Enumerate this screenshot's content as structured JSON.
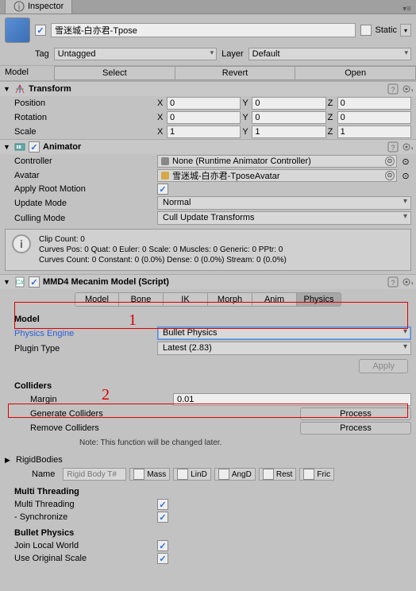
{
  "tab": {
    "title": "Inspector"
  },
  "object": {
    "enabled": true,
    "name": "雪迷城-白亦君-Tpose",
    "static_label": "Static",
    "tag_label": "Tag",
    "tag_value": "Untagged",
    "layer_label": "Layer",
    "layer_value": "Default",
    "model_label": "Model",
    "select_btn": "Select",
    "revert_btn": "Revert",
    "open_btn": "Open"
  },
  "transform": {
    "title": "Transform",
    "position_label": "Position",
    "rotation_label": "Rotation",
    "scale_label": "Scale",
    "X": "X",
    "Y": "Y",
    "Z": "Z",
    "px": "0",
    "py": "0",
    "pz": "0",
    "rx": "0",
    "ry": "0",
    "rz": "0",
    "sx": "1",
    "sy": "1",
    "sz": "1"
  },
  "animator": {
    "title": "Animator",
    "controller_label": "Controller",
    "controller_value": "None (Runtime Animator Controller)",
    "avatar_label": "Avatar",
    "avatar_value": "雪迷城-白亦君-TposeAvatar",
    "apply_root_label": "Apply Root Motion",
    "apply_root": true,
    "update_mode_label": "Update Mode",
    "update_mode": "Normal",
    "culling_mode_label": "Culling Mode",
    "culling_mode": "Cull Update Transforms",
    "info1": "Clip Count: 0",
    "info2": "Curves Pos: 0 Quat: 0 Euler: 0 Scale: 0 Muscles: 0 Generic: 0 PPtr: 0",
    "info3": "Curves Count: 0 Constant: 0 (0.0%) Dense: 0 (0.0%) Stream: 0 (0.0%)"
  },
  "mmd": {
    "title": "MMD4 Mecanim Model (Script)",
    "enabled": true,
    "tabs": [
      "Model",
      "Bone",
      "IK",
      "Morph",
      "Anim",
      "Physics"
    ],
    "active_tab": 5,
    "model_header": "Model",
    "physics_engine_label": "Physics Engine",
    "physics_engine_value": "Bullet Physics",
    "plugin_type_label": "Plugin Type",
    "plugin_type_value": "Latest (2.83)",
    "apply_btn": "Apply",
    "colliders_header": "Colliders",
    "margin_label": "Margin",
    "margin_value": "0.01",
    "generate_label": "Generate Colliders",
    "remove_label": "Remove Colliders",
    "process_btn": "Process",
    "note": "Note: This function will be changed later.",
    "rigidbodies_header": "RigidBodies",
    "name_label": "Name",
    "name_placeholder": "Rigid Body T#",
    "rb_cols": [
      "Mass",
      "LinD",
      "AngD",
      "Rest",
      "Fric"
    ],
    "multithread_header": "Multi Threading",
    "mt_label": "Multi Threading",
    "mt_checked": true,
    "sync_label": "- Synchronize",
    "sync_checked": true,
    "bullet_header": "Bullet Physics",
    "jlw_label": "Join Local World",
    "jlw_checked": true,
    "uos_label": "Use Original Scale",
    "uos_checked": true
  },
  "chart_data": {
    "type": "table"
  }
}
